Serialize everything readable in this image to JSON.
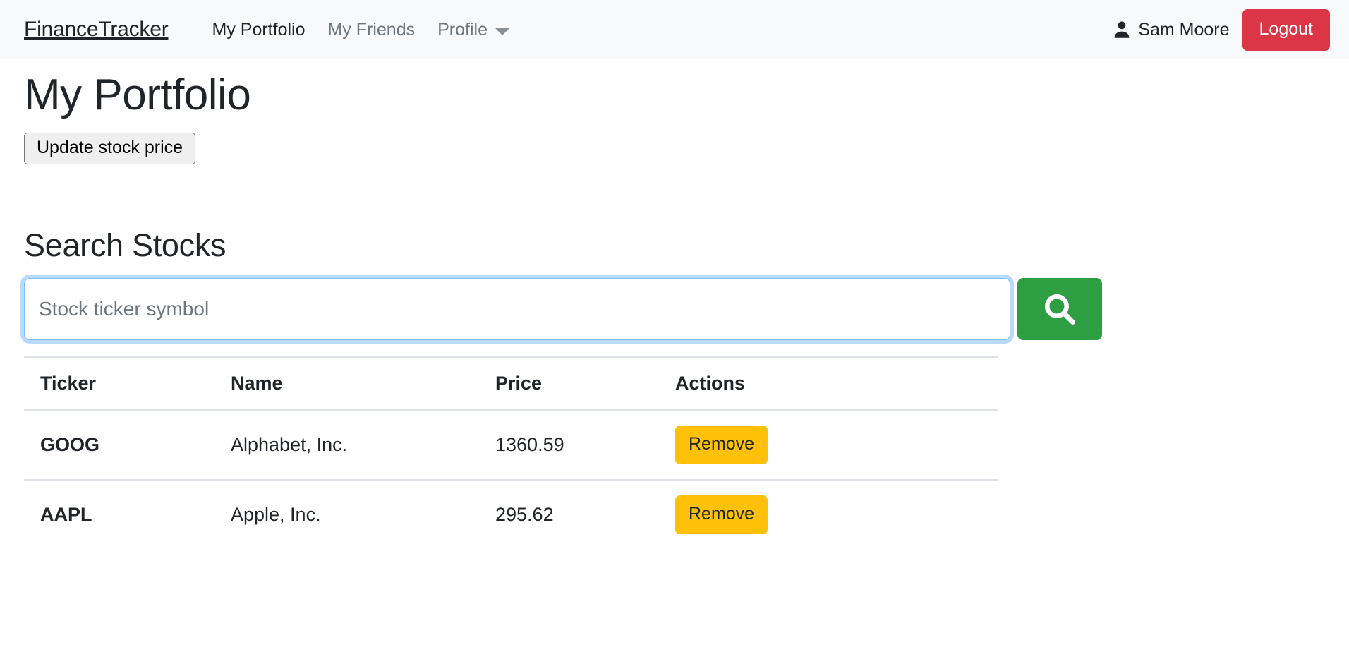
{
  "navbar": {
    "brand": "FinanceTracker",
    "links": [
      {
        "label": "My Portfolio",
        "state": "active"
      },
      {
        "label": "My Friends",
        "state": "muted"
      }
    ],
    "dropdown": {
      "label": "Profile",
      "icon": "chevron-down-icon"
    },
    "user": {
      "icon": "user-icon",
      "name": "Sam Moore"
    },
    "logout_label": "Logout",
    "background_color": "#f8f9fa",
    "logout_color": "#dc3545"
  },
  "main": {
    "page_title": "My Portfolio",
    "update_button_label": "Update stock price",
    "section_title": "Search Stocks"
  },
  "search": {
    "value": "",
    "placeholder": "Stock ticker symbol",
    "button_icon": "search-icon",
    "button_color": "#2d9e41"
  },
  "table": {
    "columns": [
      "Ticker",
      "Name",
      "Price",
      "Actions"
    ],
    "action_label": "Remove",
    "action_color": "#ffc107",
    "rows": [
      {
        "ticker": "GOOG",
        "name": "Alphabet, Inc.",
        "price": "1360.59",
        "action": "Remove"
      },
      {
        "ticker": "AAPL",
        "name": "Apple, Inc.",
        "price": "295.62",
        "action": "Remove"
      }
    ]
  }
}
